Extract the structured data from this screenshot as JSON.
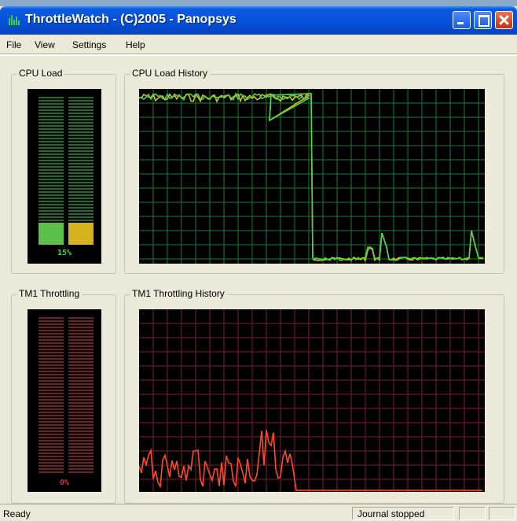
{
  "window": {
    "title": "ThrottleWatch - (C)2005 - Panopsys",
    "app_icon": "chart-icon"
  },
  "menu": {
    "items": [
      {
        "label": "File"
      },
      {
        "label": "View"
      },
      {
        "label": "Settings"
      },
      {
        "label": "Help"
      }
    ]
  },
  "cpu": {
    "load_label": "CPU Load",
    "history_label": "CPU Load History",
    "readout": "15%",
    "level_fraction": 0.15,
    "bar_colors": [
      "#5cbf47",
      "#d7b21f"
    ],
    "grid_color": "#1f7a33",
    "line_colors": [
      "#4fd24f",
      "#d9c21a"
    ]
  },
  "tm1": {
    "throttling_label": "TM1 Throttling",
    "history_label": "TM1 Throttling History",
    "readout": "0%",
    "level_fraction": 0.0,
    "grid_color": "#7a1f33",
    "line_color": "#ff4a2a"
  },
  "status": {
    "text": "Ready",
    "journal": "Journal stopped"
  }
}
